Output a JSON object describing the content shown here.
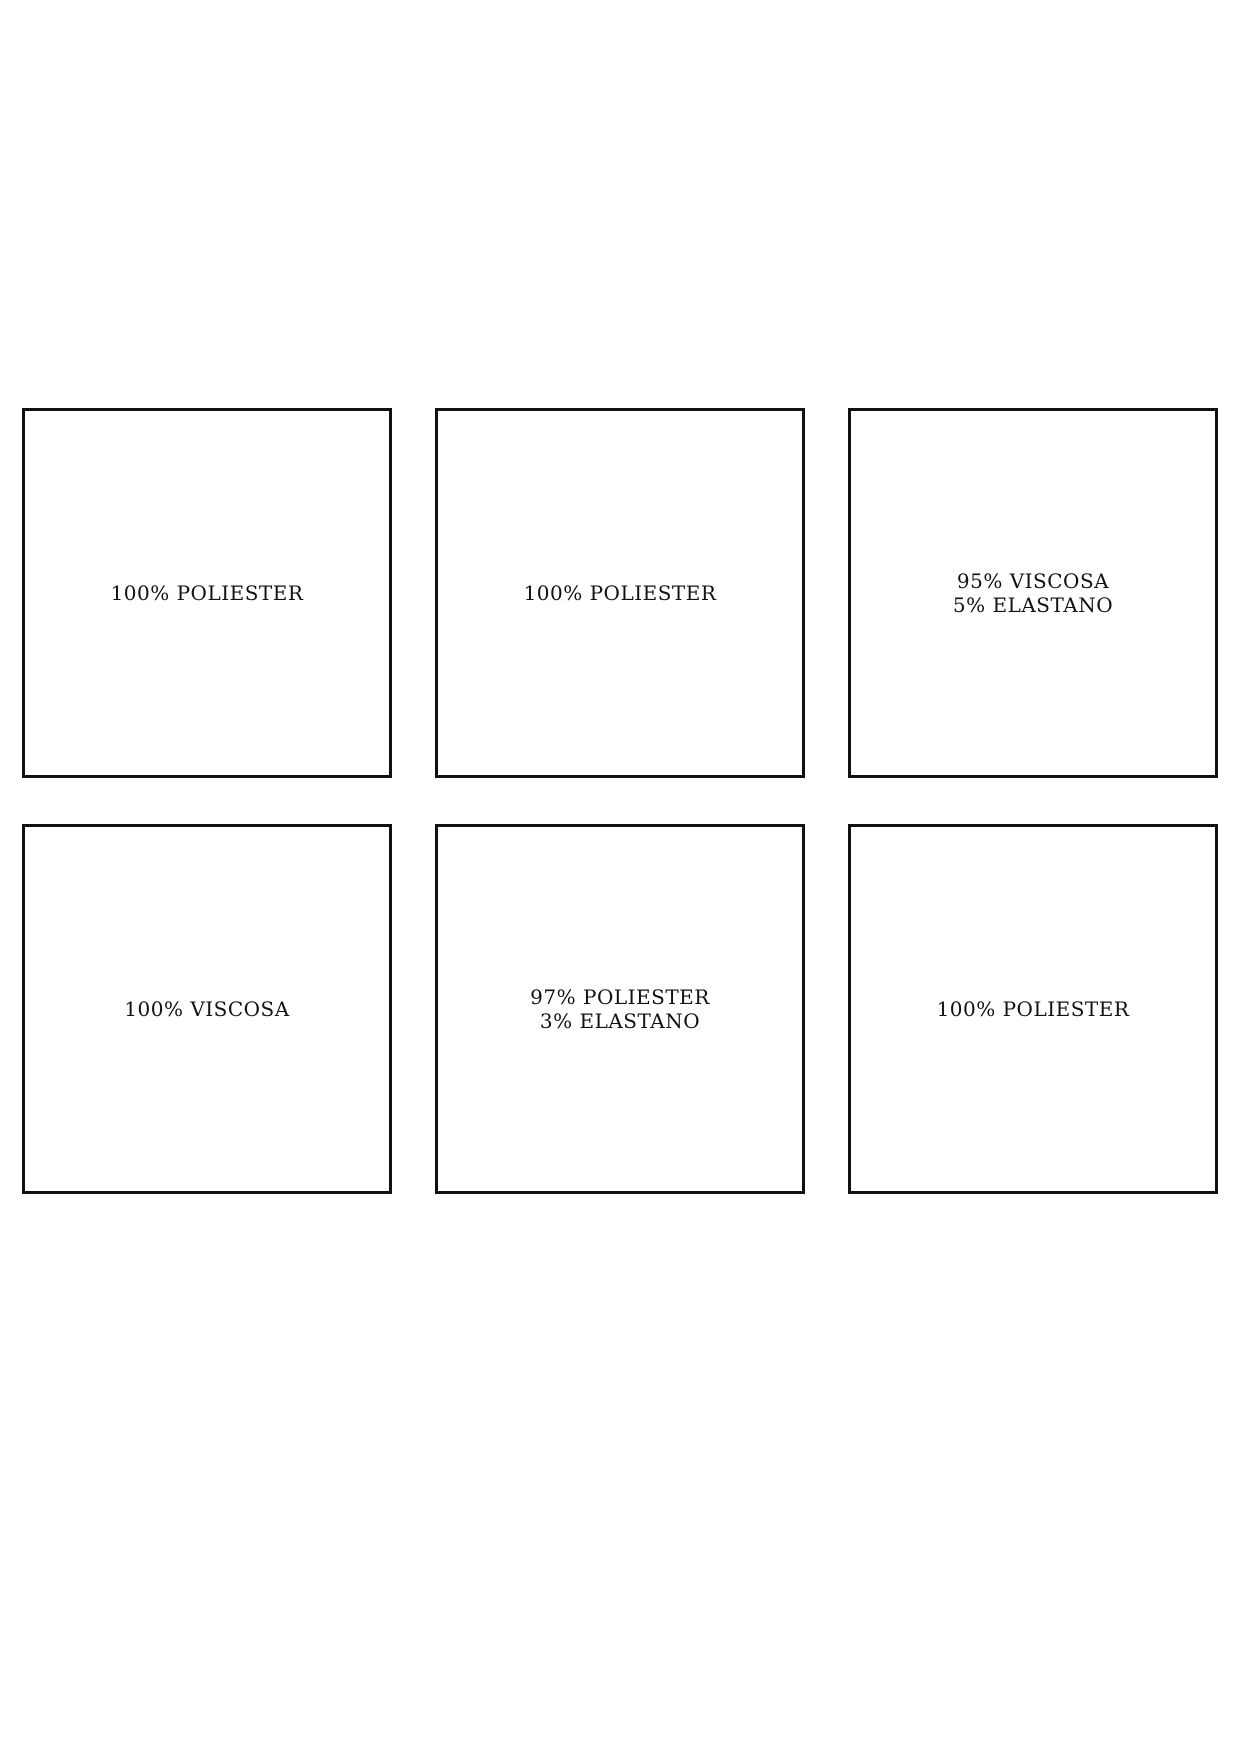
{
  "labels": [
    {
      "lines": [
        "100% POLIESTER"
      ]
    },
    {
      "lines": [
        "100% POLIESTER"
      ]
    },
    {
      "lines": [
        "95% VISCOSA",
        "5% ELASTANO"
      ]
    },
    {
      "lines": [
        "100% VISCOSA"
      ]
    },
    {
      "lines": [
        "97% POLIESTER",
        "3% ELASTANO"
      ]
    },
    {
      "lines": [
        "100% POLIESTER"
      ]
    }
  ]
}
